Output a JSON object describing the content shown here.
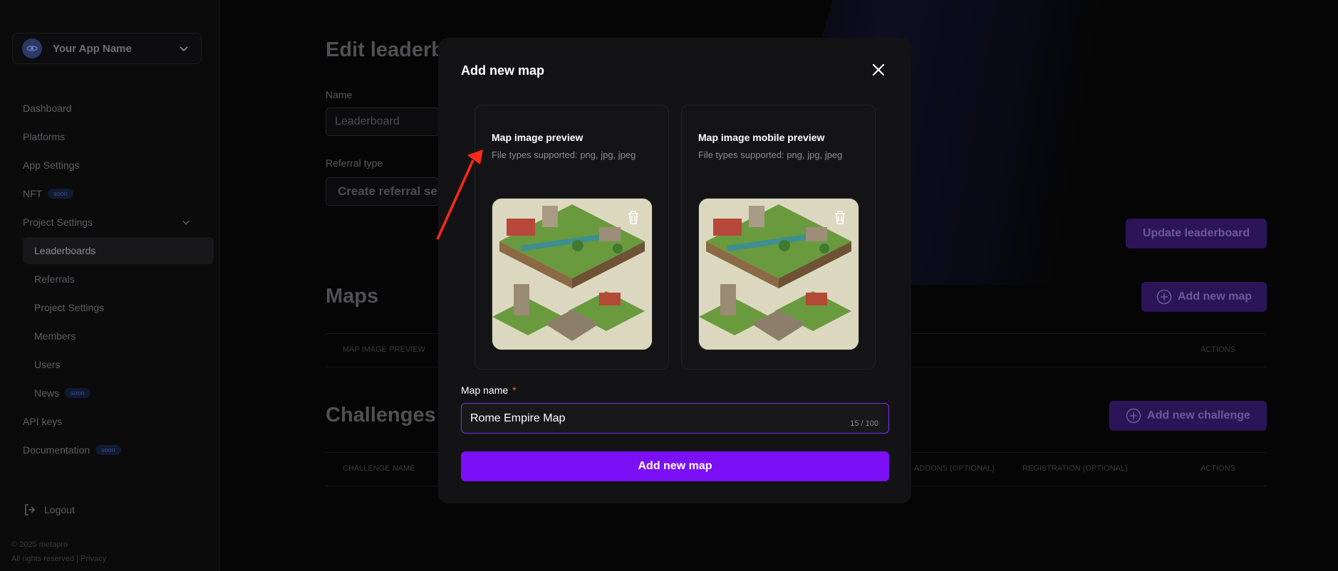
{
  "sidebar": {
    "app_name": "Your App Name",
    "items": [
      {
        "label": "Dashboard"
      },
      {
        "label": "Platforms"
      },
      {
        "label": "App Settings"
      },
      {
        "label": "NFT",
        "badge": "soon"
      },
      {
        "label": "Project Settings"
      },
      {
        "label": "Leaderboards"
      },
      {
        "label": "Referrals"
      },
      {
        "label": "Project Settings"
      },
      {
        "label": "Members"
      },
      {
        "label": "Users"
      },
      {
        "label": "News",
        "badge": "soon"
      },
      {
        "label": "API keys"
      },
      {
        "label": "Documentation",
        "badge": "soon"
      }
    ],
    "logout": "Logout",
    "footer_line1": "© 2025 metapro",
    "footer_line2": "All rights reserved | Privacy"
  },
  "page": {
    "title": "Edit leaderb",
    "name_label": "Name",
    "name_value": "Leaderboard",
    "referral_label": "Referral type",
    "referral_value": "Create referral se",
    "update_button": "Update leaderboard",
    "maps_title": "Maps",
    "add_map_button": "Add new map",
    "maps_columns": [
      "MAP IMAGE PREVIEW",
      "ACTIONS"
    ],
    "challenges_title": "Challenges",
    "add_challenge_button": "Add new challenge",
    "challenges_columns": [
      "CHALLENGE NAME",
      "ADDONS (OPTIONAL)",
      "REGISTRATION (OPTIONAL)",
      "ACTIONS"
    ]
  },
  "modal": {
    "title": "Add new map",
    "preview_title": "Map image preview",
    "preview_sub": "File types supported: png, jpg, jpeg",
    "mobile_title": "Map image mobile preview",
    "mobile_sub": "File types supported: png, jpg, jpeg",
    "map_name_label": "Map name",
    "required_mark": "*",
    "map_name_value": "Rome Empire Map",
    "counter": "15 / 100",
    "submit": "Add new map"
  },
  "colors": {
    "accent": "#7b0ff5",
    "annotation_arrow": "#ff2a1a",
    "required": "#ff6a2a"
  },
  "icons": [
    "app-logo-icon",
    "chevron-down-icon",
    "logout-icon",
    "plus-circle-icon",
    "close-icon",
    "trash-icon"
  ]
}
